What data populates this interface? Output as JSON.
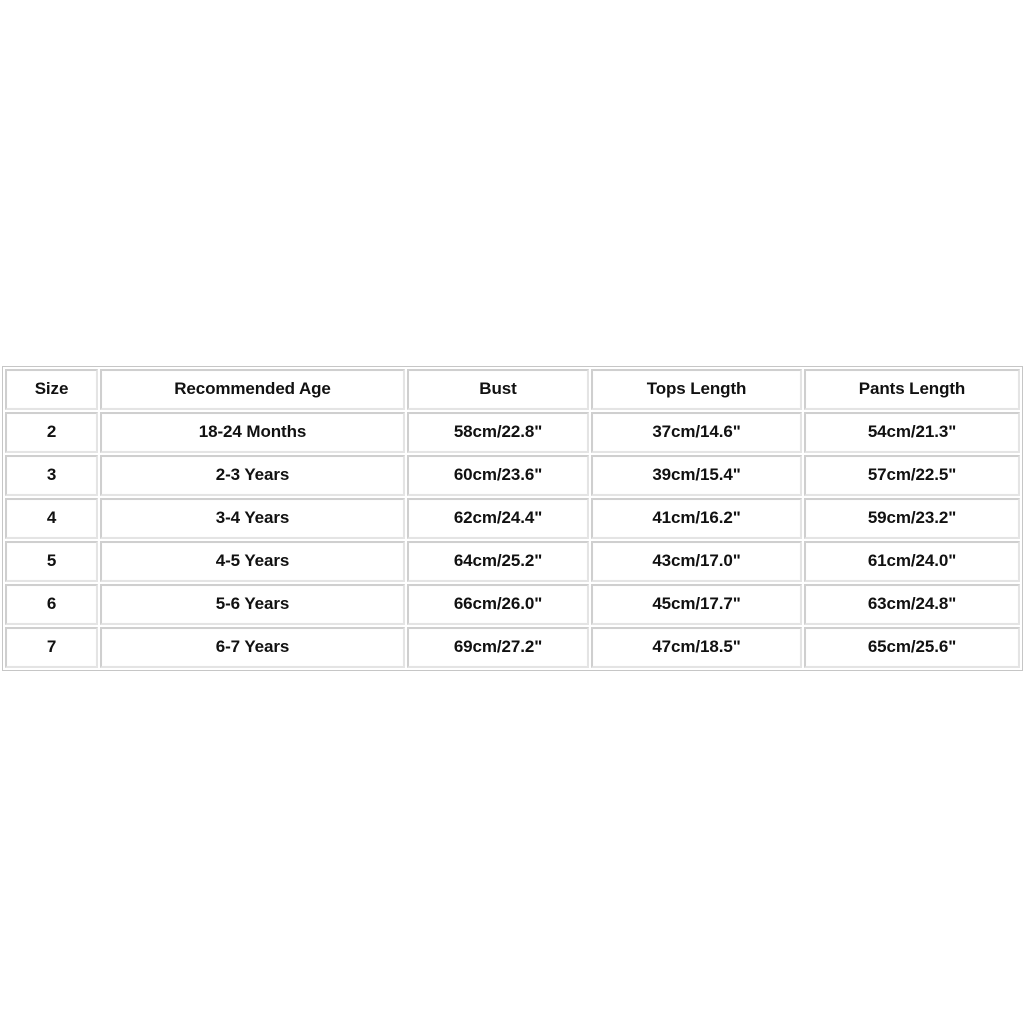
{
  "page": {
    "background_color": "#ffffff",
    "content_type": "size-chart-table"
  },
  "size_chart": {
    "border_color": "#c6c6c6",
    "cell_border_color": "#cfcfcf",
    "text_color": "#111111",
    "columns": [
      {
        "key": "size",
        "label": "Size"
      },
      {
        "key": "age",
        "label": "Recommended Age"
      },
      {
        "key": "bust",
        "label": "Bust"
      },
      {
        "key": "tops",
        "label": "Tops Length"
      },
      {
        "key": "pants",
        "label": "Pants Length"
      }
    ],
    "rows": [
      {
        "size": "2",
        "age": "18-24 Months",
        "bust": "58cm/22.8\"",
        "tops": "37cm/14.6\"",
        "pants": "54cm/21.3\""
      },
      {
        "size": "3",
        "age": "2-3 Years",
        "bust": "60cm/23.6\"",
        "tops": "39cm/15.4\"",
        "pants": "57cm/22.5\""
      },
      {
        "size": "4",
        "age": "3-4 Years",
        "bust": "62cm/24.4\"",
        "tops": "41cm/16.2\"",
        "pants": "59cm/23.2\""
      },
      {
        "size": "5",
        "age": "4-5 Years",
        "bust": "64cm/25.2\"",
        "tops": "43cm/17.0\"",
        "pants": "61cm/24.0\""
      },
      {
        "size": "6",
        "age": "5-6 Years",
        "bust": "66cm/26.0\"",
        "tops": "45cm/17.7\"",
        "pants": "63cm/24.8\""
      },
      {
        "size": "7",
        "age": "6-7 Years",
        "bust": "69cm/27.2\"",
        "tops": "47cm/18.5\"",
        "pants": "65cm/25.6\""
      }
    ]
  }
}
